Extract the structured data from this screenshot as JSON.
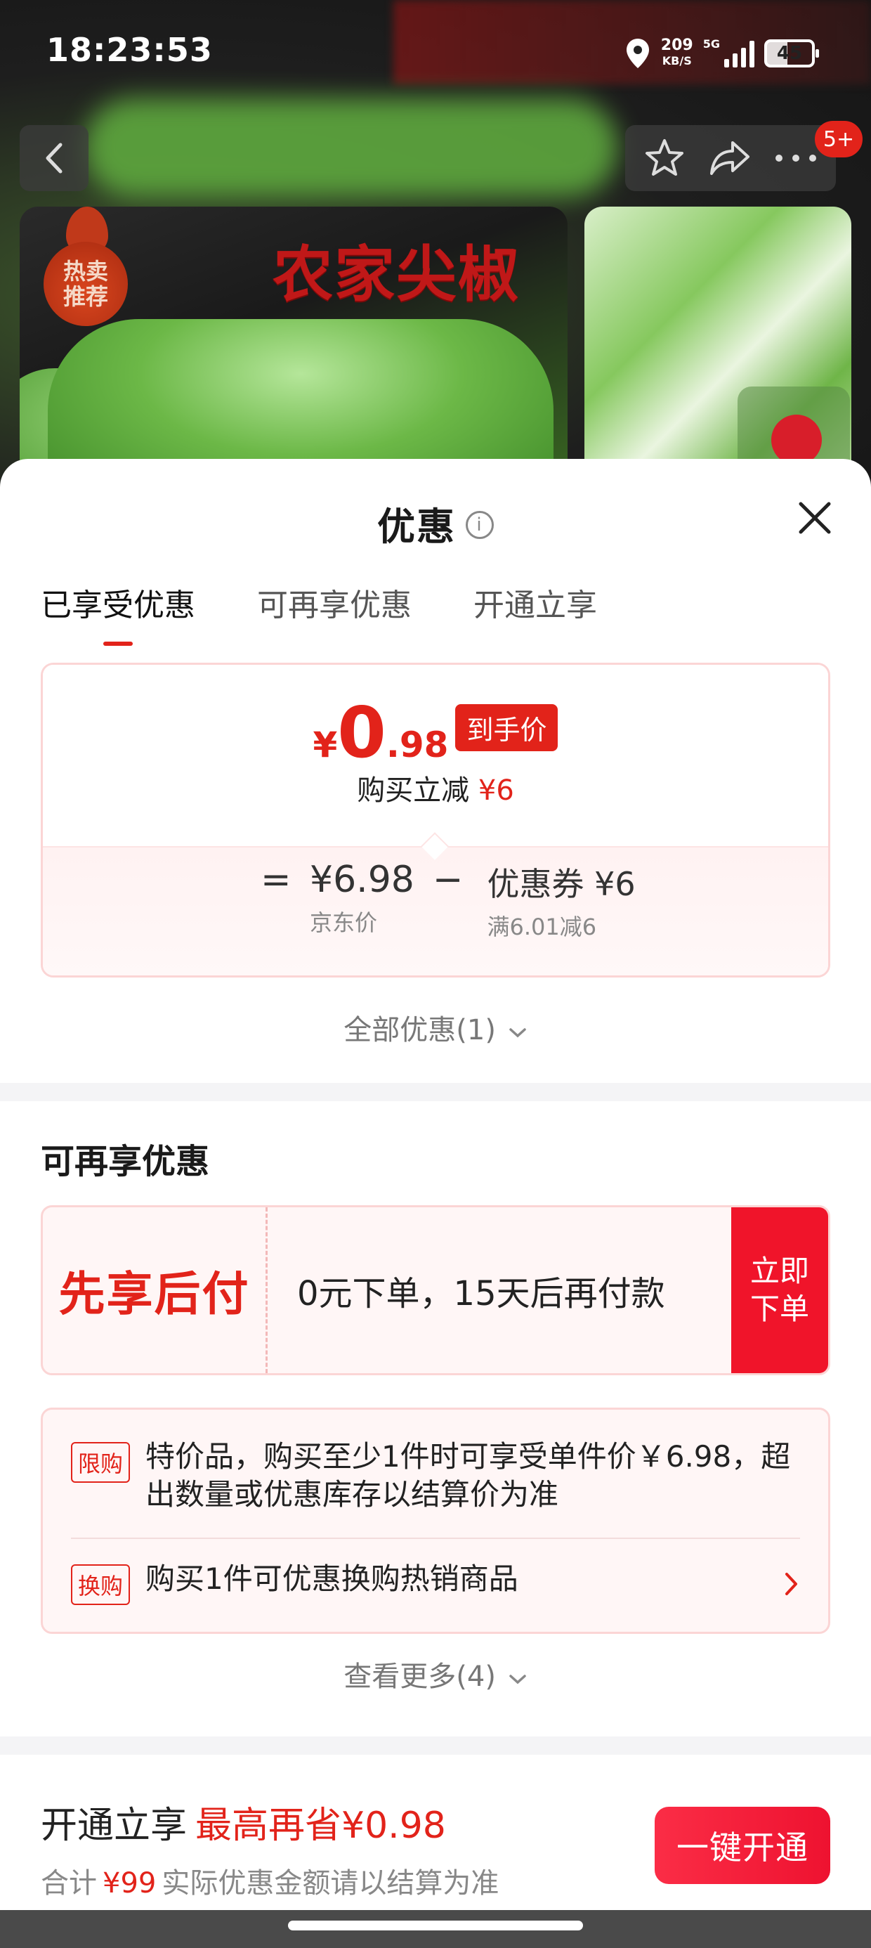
{
  "status_bar": {
    "time": "18:23:53",
    "net_speed": "209",
    "net_unit": "KB/S",
    "network": "5G",
    "battery": "45"
  },
  "top_nav": {
    "notification_badge": "5+"
  },
  "product_images": {
    "hot_badge": "热卖推荐",
    "title_overlay": "农家尖椒"
  },
  "sheet": {
    "title": "优惠",
    "tabs": [
      {
        "label": "已享受优惠",
        "active": true
      },
      {
        "label": "可再享优惠",
        "active": false
      },
      {
        "label": "开通立享",
        "active": false
      }
    ],
    "price_card": {
      "currency": "¥",
      "price_int": "0",
      "price_dec": ".98",
      "price_tag": "到手价",
      "reduce_label": "购买立减",
      "reduce_amount": "¥6",
      "equals": "=",
      "jd_price": "¥6.98",
      "jd_price_label": "京东价",
      "minus": "−",
      "coupon": "优惠券 ¥6",
      "coupon_cond": "满6.01减6"
    },
    "all_deals": "全部优惠(1)",
    "section_title": "可再享优惠",
    "bnpl": {
      "title": "先享后付",
      "desc": "0元下单，15天后再付款",
      "button": "立即下单"
    },
    "rules": [
      {
        "tag": "限购",
        "text": "特价品，购买至少1件时可享受单件价￥6.98，超出数量或优惠库存以结算价为准"
      },
      {
        "tag": "换购",
        "text": "购买1件可优惠换购热销商品"
      }
    ],
    "see_more": "查看更多(4)"
  },
  "bottom_bar": {
    "lead": "开通立享",
    "save": "最高再省¥0.98",
    "total_label": "合计",
    "total_amount": "¥99",
    "note": "实际优惠金额请以结算为准",
    "button": "一键开通"
  },
  "colors": {
    "accent": "#e2231a",
    "button_red": "#f0142a",
    "card_border": "#fbd5d5",
    "card_bg": "#fff6f6"
  }
}
